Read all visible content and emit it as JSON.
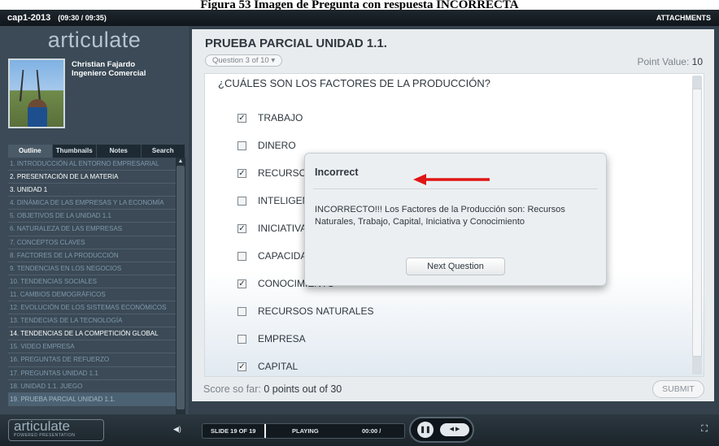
{
  "figure_caption": "Figura 53 Imagen de Pregunta con respuesta INCORRECTA",
  "topbar": {
    "course": "cap1-2013",
    "time": "(09:30 / 09:35)",
    "attachments": "ATTACHMENTS"
  },
  "sidebar": {
    "logo": "articulate",
    "presenter_name": "Christian Fajardo",
    "presenter_title": "Ingeniero Comercial",
    "tabs": [
      "Outline",
      "Thumbnails",
      "Notes",
      "Search"
    ],
    "outline": [
      {
        "label": "1. INTRODUCCIÓN AL ENTORNO EMPRESARIAL",
        "state": "dim"
      },
      {
        "label": "2. PRESENTACIÓN DE LA MATERIA",
        "state": "lit"
      },
      {
        "label": "3. Unidad 1",
        "state": "lit"
      },
      {
        "label": "4. Dinámica de las Empresas y la Economía",
        "state": "dim"
      },
      {
        "label": "5. OBJETIVOS DE LA UNIDAD 1.1",
        "state": "dim"
      },
      {
        "label": "6. NATURALEZA DE LAS EMPRESAS",
        "state": "dim"
      },
      {
        "label": "7. CONCEPTOS CLAVES",
        "state": "dim"
      },
      {
        "label": "8. FACTORES DE LA PRODUCCIÓN",
        "state": "dim"
      },
      {
        "label": "9. TENDENCIAS EN LOS NEGOCIOS",
        "state": "dim"
      },
      {
        "label": "10. TENDENCIAS SOCIALES",
        "state": "dim"
      },
      {
        "label": "11. CAMBIOS DEMOGRÁFICOS",
        "state": "dim"
      },
      {
        "label": "12. EVOLUCIÓN DE LOS SISTEMAS ECONÓMICOS",
        "state": "dim"
      },
      {
        "label": "13. TENDECIAS DE LA TECNOLOGÍA",
        "state": "dim"
      },
      {
        "label": "14. TENDENCIAS DE LA COMPETICIÓN GLOBAL",
        "state": "lit"
      },
      {
        "label": "15. VIDEO EMPRESA",
        "state": "dim"
      },
      {
        "label": "16. PREGUNTAS DE REFUERZO",
        "state": "dim"
      },
      {
        "label": "17. Preguntas Unidad 1.1",
        "state": "dim"
      },
      {
        "label": "18. Unidad 1.1. Juego",
        "state": "dim"
      },
      {
        "label": "19. PRUEBA PARCIAL UNIDAD 1.1.",
        "state": "sel"
      }
    ]
  },
  "slide": {
    "title": "PRUEBA PARCIAL UNIDAD 1.1.",
    "question_counter": "Question 3 of 10",
    "point_value_label": "Point Value:",
    "point_value": "10",
    "question": "¿CUÁLES SON LOS FACTORES DE LA PRODUCCIÓN?",
    "options": [
      {
        "label": "TRABAJO",
        "checked": true
      },
      {
        "label": "DINERO",
        "checked": false
      },
      {
        "label": "RECURSOS",
        "checked": true
      },
      {
        "label": "INTELIGENCIA",
        "checked": false
      },
      {
        "label": "INICIATIVA",
        "checked": true
      },
      {
        "label": "CAPACIDAD",
        "checked": false
      },
      {
        "label": "CONOCIMIENTO",
        "checked": true
      },
      {
        "label": "RECURSOS NATURALES",
        "checked": false
      },
      {
        "label": "EMPRESA",
        "checked": false
      },
      {
        "label": "CAPITAL",
        "checked": true
      }
    ],
    "score_label": "Score so far:",
    "score_value": "0 points out of 30",
    "submit": "SUBMIT"
  },
  "popup": {
    "title": "Incorrect",
    "message": "INCORRECTO!!! Los Factores de la Producción son: Recursos Naturales, Trabajo, Capital, Iniciativa y Conocimiento",
    "button": "Next Question",
    "arrow_color": "#e01515"
  },
  "controls": {
    "logo": "articulate",
    "logo_sub": "POWERED PRESENTATION",
    "slide_counter": "SLIDE 19 OF 19",
    "status": "PLAYING",
    "elapsed": "00:00 /"
  }
}
